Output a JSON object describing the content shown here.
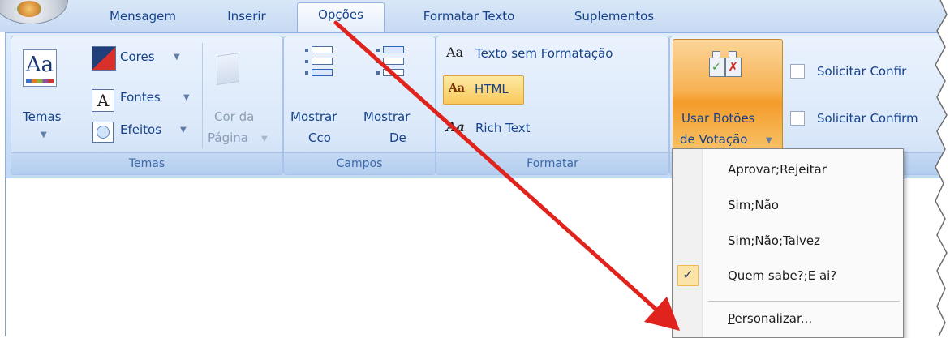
{
  "tabs": {
    "items": [
      "Mensagem",
      "Inserir",
      "Opções",
      "Formatar Texto",
      "Suplementos"
    ],
    "active": "Opções"
  },
  "groups": {
    "temas": {
      "label": "Temas",
      "temas_button": "Temas",
      "cores": "Cores",
      "fontes": "Fontes",
      "efeitos": "Efeitos",
      "cor_da": "Cor da",
      "pagina": "Página"
    },
    "campos": {
      "label": "Campos",
      "mostrar_cco_1": "Mostrar",
      "mostrar_cco_2": "Cco",
      "mostrar_de_1": "Mostrar",
      "mostrar_de_2": "De"
    },
    "formatar": {
      "label": "Formatar",
      "texto_sem_formatacao": "Texto sem Formatação",
      "html": "HTML",
      "rich_text": "Rich Text",
      "aa": "Aa"
    },
    "votacao": {
      "button_line1": "Usar Botões",
      "button_line2": "de Votação",
      "solicitar_1": "Solicitar Confir",
      "solicitar_2": "Solicitar Confirm"
    }
  },
  "menu": {
    "items": [
      "Aprovar;Rejeitar",
      "Sim;Não",
      "Sim;Não;Talvez",
      "Quem sabe?;E ai?"
    ],
    "checked_index": 3,
    "personalizar_first": "P",
    "personalizar_rest": "ersonalizar...",
    "check_glyph": "✓"
  },
  "colors": {
    "annotation_arrow": "#e0231c",
    "vote_button": "#f7b253",
    "html_button": "#f9c85b"
  }
}
